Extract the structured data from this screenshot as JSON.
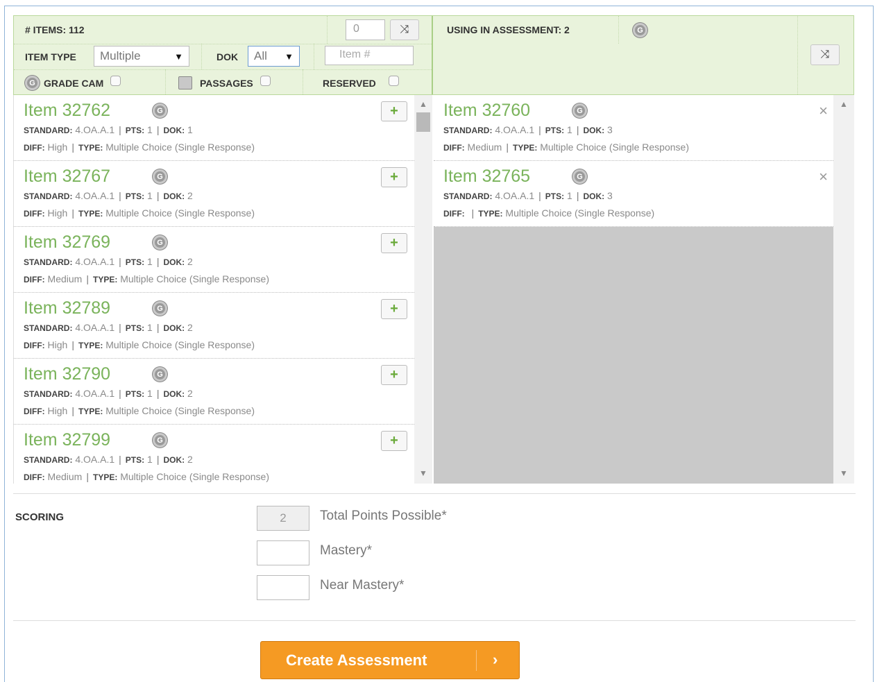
{
  "pool": {
    "count_label": "# ITEMS: 112",
    "count_input": "0",
    "item_type_label": "ITEM TYPE",
    "item_type_value": "Multiple",
    "dok_label": "DOK",
    "dok_value": "All",
    "item_number_placeholder": "Item #",
    "grade_cam_label": "GRADE CAM",
    "passages_label": "PASSAGES",
    "reserved_label": "RESERVED",
    "items": [
      {
        "title": "Item 32762",
        "standard": "4.OA.A.1",
        "pts": "1",
        "dok": "1",
        "diff": "High",
        "type": "Multiple Choice (Single Response)"
      },
      {
        "title": "Item 32767",
        "standard": "4.OA.A.1",
        "pts": "1",
        "dok": "2",
        "diff": "High",
        "type": "Multiple Choice (Single Response)"
      },
      {
        "title": "Item 32769",
        "standard": "4.OA.A.1",
        "pts": "1",
        "dok": "2",
        "diff": "Medium",
        "type": "Multiple Choice (Single Response)"
      },
      {
        "title": "Item 32789",
        "standard": "4.OA.A.1",
        "pts": "1",
        "dok": "2",
        "diff": "High",
        "type": "Multiple Choice (Single Response)"
      },
      {
        "title": "Item 32790",
        "standard": "4.OA.A.1",
        "pts": "1",
        "dok": "2",
        "diff": "High",
        "type": "Multiple Choice (Single Response)"
      },
      {
        "title": "Item 32799",
        "standard": "4.OA.A.1",
        "pts": "1",
        "dok": "2",
        "diff": "Medium",
        "type": "Multiple Choice (Single Response)"
      }
    ]
  },
  "selected": {
    "using_label": "USING IN ASSESSMENT: 2",
    "items": [
      {
        "title": "Item 32760",
        "standard": "4.OA.A.1",
        "pts": "1",
        "dok": "3",
        "diff": "Medium",
        "type": "Multiple Choice (Single Response)"
      },
      {
        "title": "Item 32765",
        "standard": "4.OA.A.1",
        "pts": "1",
        "dok": "3",
        "diff": "",
        "type": "Multiple Choice (Single Response)"
      }
    ]
  },
  "labels": {
    "standard": "STANDARD:",
    "pts": "PTS:",
    "dok": "DOK:",
    "diff": "DIFF:",
    "type": "TYPE:",
    "add": "+",
    "remove": "×",
    "gradecam_glyph": "G",
    "shuffle_glyph": "⤨"
  },
  "scoring": {
    "label": "SCORING",
    "total_value": "2",
    "total_label": "Total Points Possible*",
    "mastery_value": "",
    "mastery_label": "Mastery*",
    "near_value": "",
    "near_label": "Near Mastery*"
  },
  "create_button": "Create Assessment",
  "create_chevron": "›",
  "colors": {
    "accent_green": "#7ab35b",
    "button_orange": "#f59a23",
    "header_bg": "#e9f3dc"
  }
}
